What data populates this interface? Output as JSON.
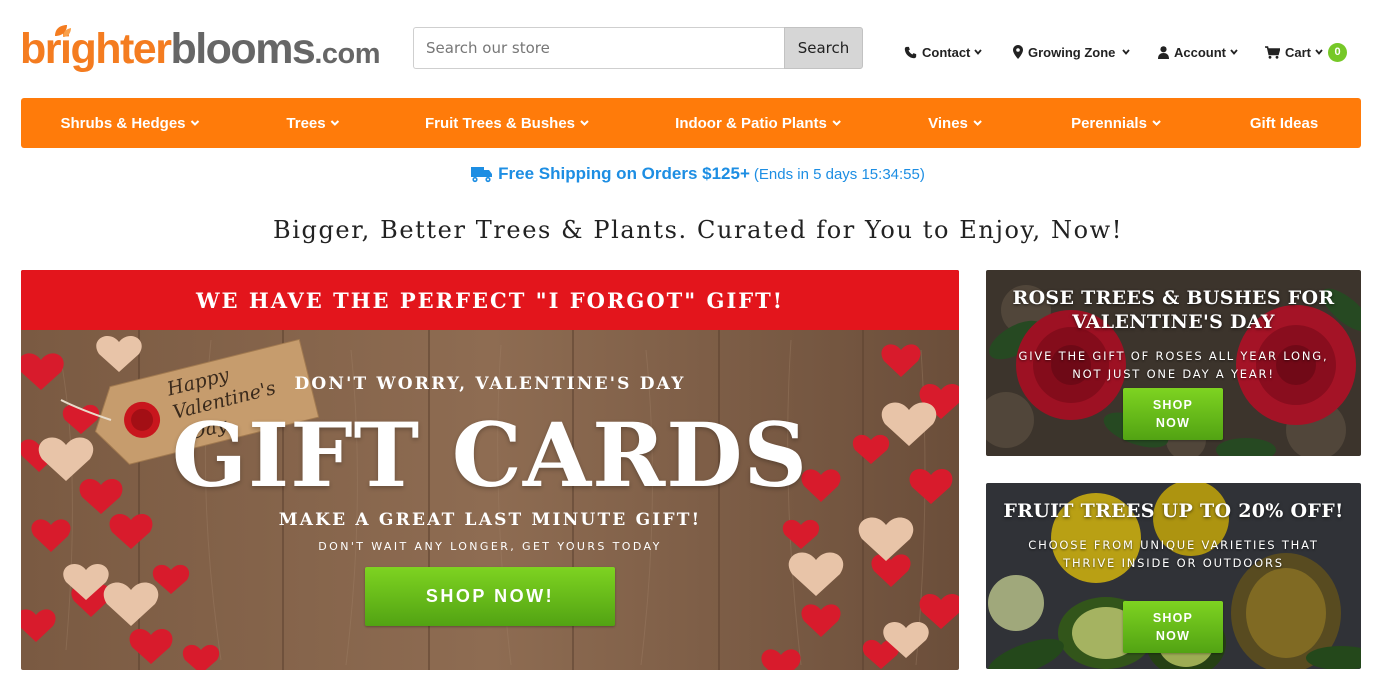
{
  "brand": {
    "logo_part1": "brighter",
    "logo_part2": "blooms",
    "logo_suffix": ".com",
    "primary_color": "#f47c20",
    "secondary_color": "#666666"
  },
  "search": {
    "placeholder": "Search our store",
    "value": "",
    "button_label": "Search"
  },
  "utility_nav": {
    "contact": "Contact",
    "growing_zone": "Growing Zone",
    "account": "Account",
    "cart": "Cart",
    "cart_count": "0"
  },
  "main_nav": {
    "bg_color": "#ff7b0a",
    "items": [
      {
        "label": "Shrubs & Hedges",
        "has_dropdown": true
      },
      {
        "label": "Trees",
        "has_dropdown": true
      },
      {
        "label": "Fruit Trees & Bushes",
        "has_dropdown": true
      },
      {
        "label": "Indoor & Patio Plants",
        "has_dropdown": true
      },
      {
        "label": "Vines",
        "has_dropdown": true
      },
      {
        "label": "Perennials",
        "has_dropdown": true
      },
      {
        "label": "Gift Ideas",
        "has_dropdown": false
      }
    ]
  },
  "promo_bar": {
    "main": "Free Shipping on Orders $125+",
    "countdown": "(Ends in 5 days 15:34:55)",
    "color": "#1d8ee3"
  },
  "tagline": "Bigger, Better Trees & Plants. Curated for You to Enjoy, Now!",
  "hero": {
    "header": "WE HAVE THE PERFECT \"I FORGOT\" GIFT!",
    "header_color": "#e3151c",
    "tag_text_line1": "Happy",
    "tag_text_line2": "Valentine's",
    "tag_text_line3": "Day",
    "subheading": "DON'T WORRY, VALENTINE'S DAY",
    "big_text": "GIFT CARDS",
    "subheading2": "MAKE A GREAT LAST MINUTE GIFT!",
    "small_text": "DON'T WAIT ANY LONGER, GET YOURS TODAY",
    "button_label": "SHOP NOW!"
  },
  "side_promos": [
    {
      "title_line1": "ROSE TREES & BUSHES FOR",
      "title_line2": "VALENTINE'S DAY",
      "text_line1": "GIVE THE GIFT OF ROSES ALL YEAR LONG,",
      "text_line2": "NOT JUST ONE DAY A YEAR!",
      "button_line1": "SHOP",
      "button_line2": "NOW"
    },
    {
      "title_line1": "FRUIT TREES UP TO 20% OFF!",
      "text_line1": "CHOOSE FROM UNIQUE VARIETIES THAT",
      "text_line2": "THRIVE INSIDE OR OUTDOORS",
      "button_line1": "SHOP",
      "button_line2": "NOW"
    }
  ],
  "icons": {
    "phone": "phone-icon",
    "location": "map-pin-icon",
    "account": "user-icon",
    "cart": "cart-icon",
    "chevron": "chevron-down-icon",
    "truck": "truck-icon"
  },
  "button_green": "#6cc11f"
}
